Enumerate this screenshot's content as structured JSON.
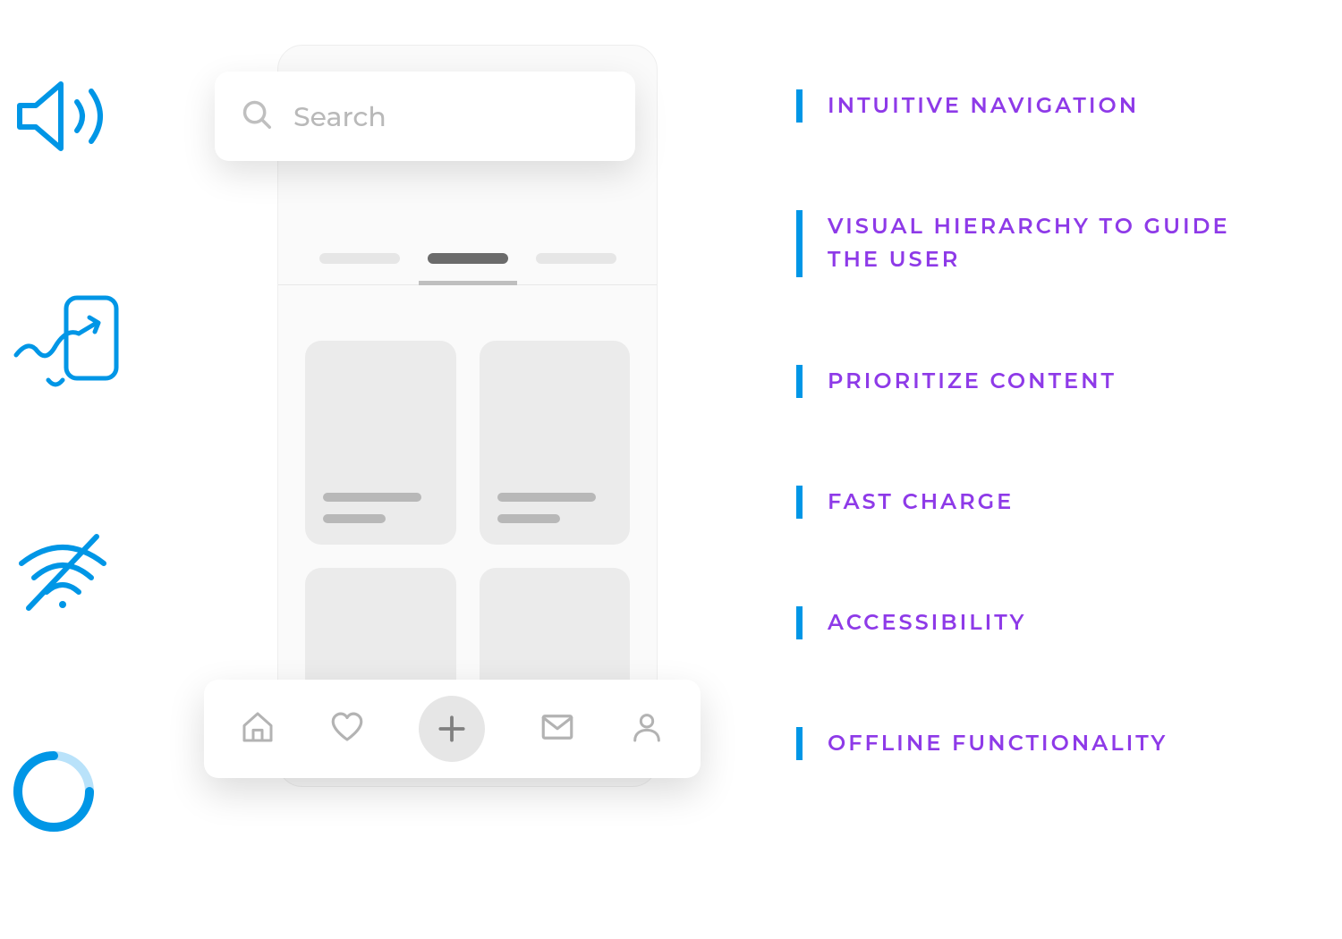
{
  "phone": {
    "search_placeholder": "Search"
  },
  "features": [
    {
      "label": "INTUITIVE NAVIGATION"
    },
    {
      "label": "VISUAL HIERARCHY TO GUIDE THE USER"
    },
    {
      "label": "PRIORITIZE CONTENT"
    },
    {
      "label": "FAST CHARGE"
    },
    {
      "label": "ACCESSIBILITY"
    },
    {
      "label": "OFFLINE FUNCTIONALITY"
    }
  ],
  "left_icons": [
    {
      "name": "speaker-icon"
    },
    {
      "name": "swipe-gesture-icon"
    },
    {
      "name": "wifi-off-icon"
    },
    {
      "name": "loading-spinner-icon"
    }
  ],
  "nav_icons": [
    {
      "name": "home-icon"
    },
    {
      "name": "heart-icon"
    },
    {
      "name": "plus-icon"
    },
    {
      "name": "mail-icon"
    },
    {
      "name": "profile-icon"
    }
  ],
  "colors": {
    "accent_blue": "#0096e6",
    "accent_purple": "#8e3ae8"
  }
}
